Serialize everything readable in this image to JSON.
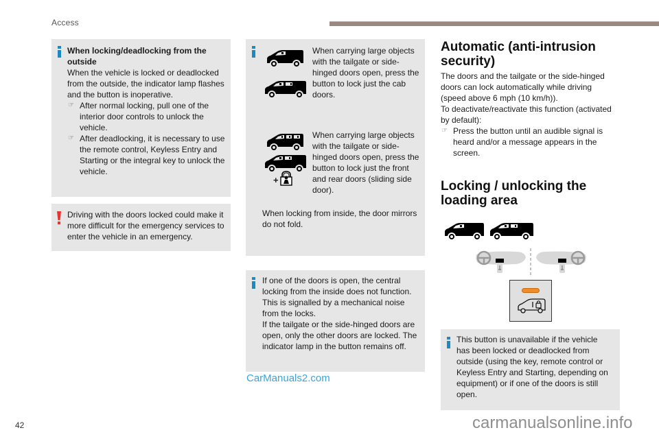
{
  "header": {
    "section_title": "Access"
  },
  "left_column": {
    "info_box": {
      "heading": "When locking/deadlocking from the outside",
      "paragraph": "When the vehicle is locked or deadlocked from the outside, the indicator lamp flashes and the button is inoperative.",
      "bullets": [
        "After normal locking, pull one of the interior door controls to unlock the vehicle.",
        "After deadlocking, it is necessary to use the remote control, Keyless Entry and Starting or the integral key to unlock the vehicle."
      ],
      "icon": "info-icon"
    },
    "warning_box": {
      "text": "Driving with the doors locked could make it more difficult for the emergency services to enter the vehicle in an emergency.",
      "icon": "warning-icon"
    }
  },
  "middle_column": {
    "info_box_1": {
      "item1_text": "When carrying large objects with the tailgate or side-hinged doors open, press the button to lock just the cab doors.",
      "item2_text": "When carrying large objects with the tailgate or side-hinged doors open, press the button to lock just the front and rear doors (sliding side door).",
      "plus_symbol": "+",
      "note": "When locking from inside, the door mirrors do not fold.",
      "icons": [
        "van-icon",
        "long-van-icon",
        "combi-van-icon",
        "long-combi-van-icon",
        "child-lock-icon"
      ]
    },
    "info_box_2": {
      "text": "If one of the doors is open, the central locking from the inside does not function. This is signalled by a mechanical noise from the locks.\nIf the tailgate or the side-hinged doors are open, only the other doors are locked. The indicator lamp in the button remains off.",
      "lines": [
        "If one of the doors is open, the central",
        "locking from the inside does not function.",
        "This is signalled by a mechanical noise",
        "from the locks.",
        "If the tailgate or the side-hinged doors are",
        "open, only the other doors are locked. The",
        "indicator lamp in the button remains off."
      ]
    }
  },
  "right_column": {
    "section1": {
      "title_line1": "Automatic (anti-intrusion",
      "title_line2": "security)",
      "paragraph1_lines": [
        "The doors and the tailgate or the side-hinged",
        "doors can lock automatically while driving",
        "(speed above 6 mph (10 km/h))."
      ],
      "paragraph2_lines": [
        "To deactivate/reactivate this function (activated",
        "by default):"
      ],
      "bullet": "Press the button until an audible signal is heard and/or a message appears in the screen."
    },
    "section2": {
      "title_line1": "Locking / unlocking the",
      "title_line2": "loading area",
      "illustration": {
        "icons": [
          "van-icon",
          "long-van-icon",
          "dashboard-lhd-icon",
          "dashboard-rhd-icon",
          "loading-area-lock-button-icon"
        ],
        "indicator_lamp_color": "#f28c28"
      }
    },
    "info_box": {
      "lines": [
        "This button is unavailable if the vehicle",
        "has been locked or deadlocked from",
        "outside (using the key, remote control or",
        "Keyless Entry and Starting, depending on",
        "equipment) or if one of the doors is still",
        "open."
      ]
    }
  },
  "footer": {
    "page_number": "42",
    "watermark_center": "CarManuals2.com",
    "watermark_right": "carmanualsonline.info"
  },
  "colors": {
    "info_blue": "#1b8ac4",
    "warning_red": "#e8332f",
    "box_gray": "#e6e6e6",
    "header_bar": "#9a8880",
    "indicator_orange": "#f28c28",
    "watermark_blue": "#3aa3db"
  }
}
